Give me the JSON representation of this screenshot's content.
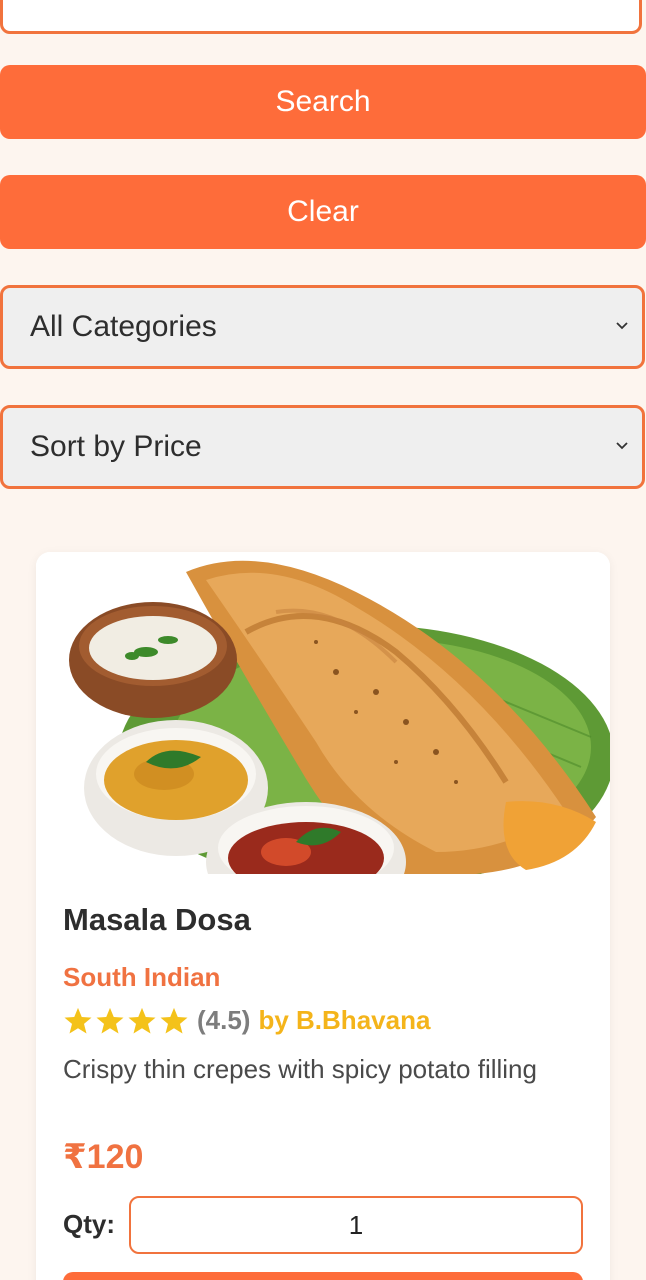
{
  "search": {
    "value": "",
    "button_label": "Search",
    "clear_label": "Clear"
  },
  "filters": {
    "category_selected": "All Categories",
    "sort_selected": "Sort by Price"
  },
  "item": {
    "name": "Masala Dosa",
    "category": "South Indian",
    "rating": 4.5,
    "rating_text": "(4.5)",
    "author": "by B.Bhavana",
    "description": "Crispy thin crepes with spicy potato filling",
    "price": "₹120",
    "qty_label": "Qty:",
    "qty_value": "1",
    "image_icon": "masala-dosa-photo"
  },
  "colors": {
    "accent": "#fe6c3a",
    "border": "#f1733d",
    "star": "#f4c21a",
    "background": "#fdf5ef"
  }
}
